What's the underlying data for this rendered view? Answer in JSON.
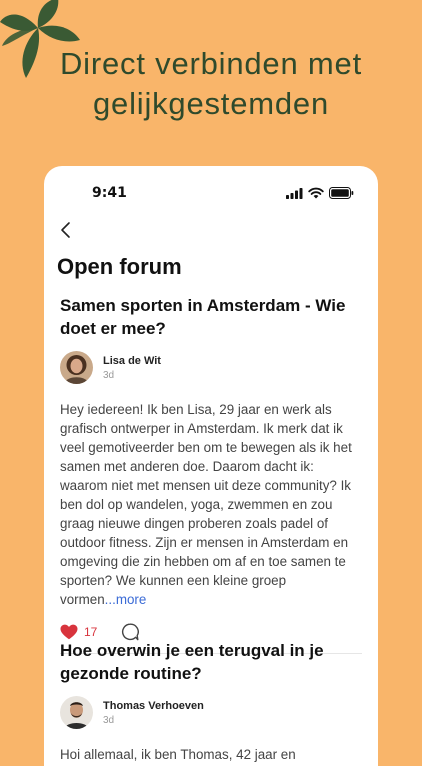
{
  "headline": {
    "line1": "Direct verbinden met",
    "line2": "gelijkgestemden"
  },
  "status_bar": {
    "time": "9:41"
  },
  "screen": {
    "title": "Open forum"
  },
  "posts": [
    {
      "title": "Samen sporten in Amsterdam - Wie doet er mee?",
      "author": "Lisa de Wit",
      "time": "3d",
      "body": "Hey iedereen! Ik ben Lisa, 29 jaar en werk als grafisch ontwerper in Amsterdam. Ik merk dat ik veel gemotiveerder ben om te bewegen als ik het samen met anderen doe. Daarom dacht ik: waarom niet met mensen uit deze community? Ik ben dol op wandelen, yoga, zwemmen en zou graag nieuwe dingen proberen zoals padel of outdoor fitness. Zijn er mensen in Amsterdam en omgeving die zin hebben om af en toe samen te sporten? We kunnen een kleine groep vormen",
      "more_label": "...more",
      "likes": "17"
    },
    {
      "title": "Hoe overwin je een terugval in je gezonde routine?",
      "author": "Thomas Verhoeven",
      "time": "3d",
      "body": "Hoi allemaal, ik ben Thomas, 42 jaar en"
    }
  ],
  "colors": {
    "background": "#F9B56A",
    "headline": "#2F4A2C",
    "leaf": "#3A5A34",
    "like": "#D8343D",
    "link": "#3B6BD6"
  },
  "icons": [
    "leaf-decoration-icon",
    "signal-icon",
    "wifi-icon",
    "battery-icon",
    "back-chevron-icon",
    "heart-icon",
    "comment-icon"
  ]
}
